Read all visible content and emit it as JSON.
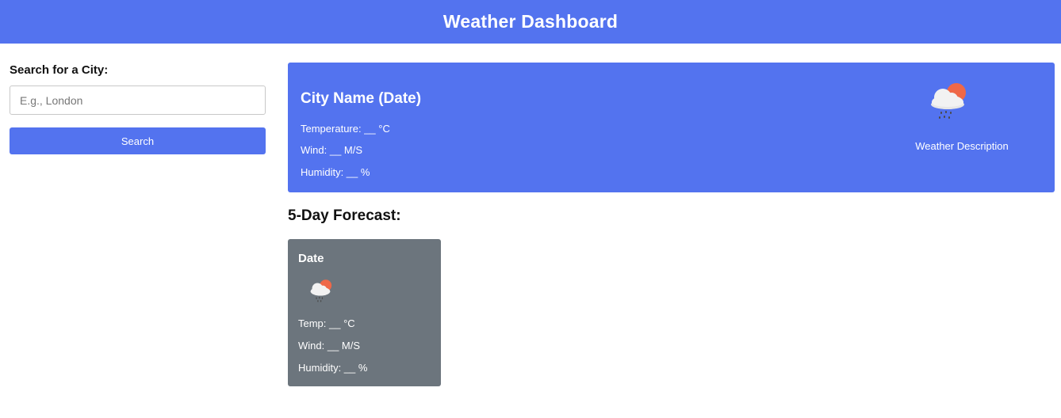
{
  "header": {
    "title": "Weather Dashboard"
  },
  "search": {
    "label": "Search for a City:",
    "placeholder": "E.g., London",
    "value": "",
    "button_label": "Search"
  },
  "current": {
    "heading": "City Name (Date)",
    "temperature": "Temperature: __ °C",
    "wind": "Wind: __ M/S",
    "humidity": "Humidity: __ %",
    "icon": "cloud-rain-sun-icon",
    "description": "Weather Description"
  },
  "forecast": {
    "heading": "5-Day Forecast:",
    "days": [
      {
        "date": "Date",
        "icon": "cloud-rain-sun-icon",
        "temp": "Temp: __ °C",
        "wind": "Wind: __ M/S",
        "humidity": "Humidity: __ %"
      }
    ]
  },
  "colors": {
    "accent": "#5373ef",
    "forecast_card": "#6c757d",
    "sun": "#ef6848",
    "cloud": "#f2f2f2",
    "rain": "#4a4a4a"
  }
}
